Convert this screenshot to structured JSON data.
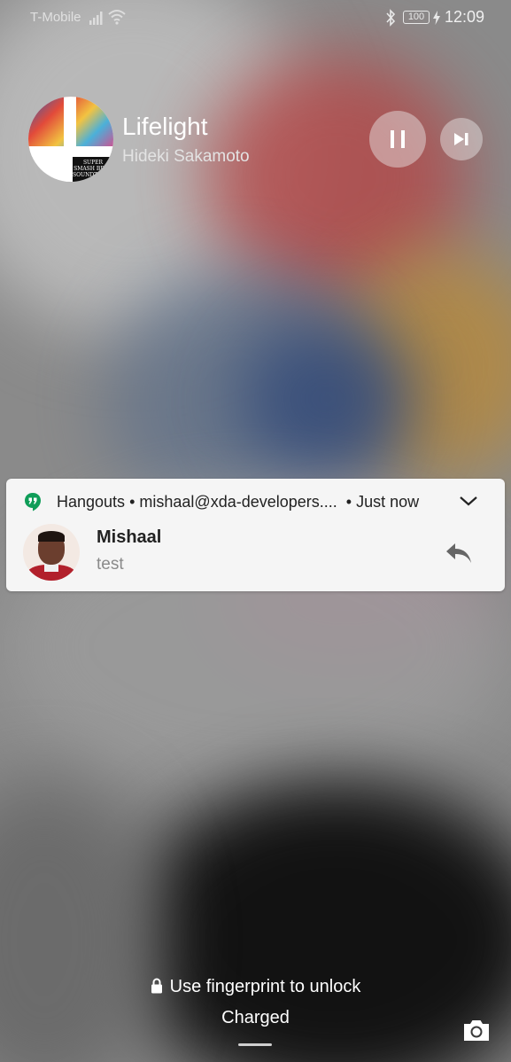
{
  "status_bar": {
    "carrier": "T-Mobile",
    "battery": "100",
    "time": "12:09",
    "icons": [
      "signal-icon",
      "wifi-icon",
      "bluetooth-icon",
      "battery-icon",
      "charging-icon"
    ]
  },
  "media": {
    "title": "Lifelight",
    "artist": "Hideki Sakamoto",
    "album_logo_text": "SUPER SMASH BROS SOUNDTRACK",
    "controls": [
      "pause-icon",
      "skip-next-icon"
    ]
  },
  "notification": {
    "app": "Hangouts",
    "account": "mishaal@xda-developers....",
    "time": "Just now",
    "sender": "Mishaal",
    "message": "test",
    "accent": "#0f9d58",
    "icons": [
      "hangouts-icon",
      "chevron-down-icon",
      "reply-icon"
    ]
  },
  "lockscreen": {
    "unlock_hint": "Use fingerprint to unlock",
    "charge_status": "Charged",
    "icons": [
      "lock-icon",
      "camera-icon"
    ]
  }
}
